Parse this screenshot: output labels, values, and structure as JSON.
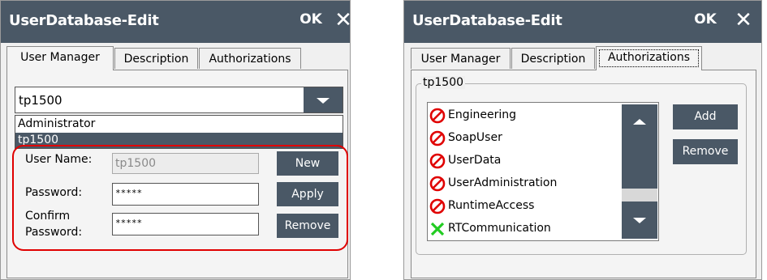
{
  "left_window": {
    "title": "UserDatabase-Edit",
    "ok_label": "OK",
    "close_symbol": "✕",
    "tabs": [
      {
        "label": "User Manager",
        "active": true
      },
      {
        "label": "Description",
        "active": false
      },
      {
        "label": "Authorizations",
        "active": false
      }
    ],
    "user_select": {
      "value": "tp1500",
      "options": [
        "Administrator",
        "tp1500"
      ],
      "selected_option": "tp1500"
    },
    "form": {
      "username_label": "User Name:",
      "username_value": "tp1500",
      "password_label": "Password:",
      "password_value": "*****",
      "confirm_label_line1": "Confirm",
      "confirm_label_line2": "Password:",
      "confirm_value": "*****"
    },
    "buttons": {
      "new": "New",
      "apply": "Apply",
      "remove": "Remove"
    },
    "highlight_color": "#e00000"
  },
  "right_window": {
    "title": "UserDatabase-Edit",
    "ok_label": "OK",
    "close_symbol": "✕",
    "tabs": [
      {
        "label": "User Manager",
        "active": false
      },
      {
        "label": "Description",
        "active": false
      },
      {
        "label": "Authorizations",
        "active": true
      }
    ],
    "group_label": "tp1500",
    "authorizations": [
      {
        "label": "Engineering",
        "icon": "denied-icon"
      },
      {
        "label": "SoapUser",
        "icon": "denied-icon"
      },
      {
        "label": "UserData",
        "icon": "denied-icon"
      },
      {
        "label": "UserAdministration",
        "icon": "denied-icon"
      },
      {
        "label": "RuntimeAccess",
        "icon": "denied-icon"
      },
      {
        "label": "RTCommunication",
        "icon": "granted-icon"
      }
    ],
    "buttons": {
      "add": "Add",
      "remove": "Remove"
    }
  },
  "colors": {
    "titlebar": "#4a5866",
    "button": "#4a5866",
    "denied": "#e00000",
    "granted": "#22cc22"
  }
}
